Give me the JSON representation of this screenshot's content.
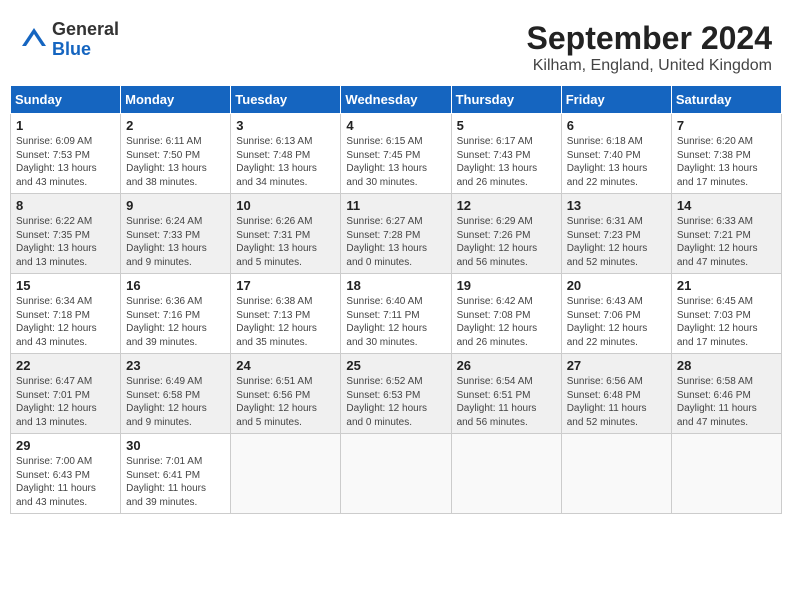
{
  "logo": {
    "general": "General",
    "blue": "Blue"
  },
  "header": {
    "month": "September 2024",
    "location": "Kilham, England, United Kingdom"
  },
  "weekdays": [
    "Sunday",
    "Monday",
    "Tuesday",
    "Wednesday",
    "Thursday",
    "Friday",
    "Saturday"
  ],
  "weeks": [
    [
      {
        "day": "1",
        "info": "Sunrise: 6:09 AM\nSunset: 7:53 PM\nDaylight: 13 hours\nand 43 minutes."
      },
      {
        "day": "2",
        "info": "Sunrise: 6:11 AM\nSunset: 7:50 PM\nDaylight: 13 hours\nand 38 minutes."
      },
      {
        "day": "3",
        "info": "Sunrise: 6:13 AM\nSunset: 7:48 PM\nDaylight: 13 hours\nand 34 minutes."
      },
      {
        "day": "4",
        "info": "Sunrise: 6:15 AM\nSunset: 7:45 PM\nDaylight: 13 hours\nand 30 minutes."
      },
      {
        "day": "5",
        "info": "Sunrise: 6:17 AM\nSunset: 7:43 PM\nDaylight: 13 hours\nand 26 minutes."
      },
      {
        "day": "6",
        "info": "Sunrise: 6:18 AM\nSunset: 7:40 PM\nDaylight: 13 hours\nand 22 minutes."
      },
      {
        "day": "7",
        "info": "Sunrise: 6:20 AM\nSunset: 7:38 PM\nDaylight: 13 hours\nand 17 minutes."
      }
    ],
    [
      {
        "day": "8",
        "info": "Sunrise: 6:22 AM\nSunset: 7:35 PM\nDaylight: 13 hours\nand 13 minutes."
      },
      {
        "day": "9",
        "info": "Sunrise: 6:24 AM\nSunset: 7:33 PM\nDaylight: 13 hours\nand 9 minutes."
      },
      {
        "day": "10",
        "info": "Sunrise: 6:26 AM\nSunset: 7:31 PM\nDaylight: 13 hours\nand 5 minutes."
      },
      {
        "day": "11",
        "info": "Sunrise: 6:27 AM\nSunset: 7:28 PM\nDaylight: 13 hours\nand 0 minutes."
      },
      {
        "day": "12",
        "info": "Sunrise: 6:29 AM\nSunset: 7:26 PM\nDaylight: 12 hours\nand 56 minutes."
      },
      {
        "day": "13",
        "info": "Sunrise: 6:31 AM\nSunset: 7:23 PM\nDaylight: 12 hours\nand 52 minutes."
      },
      {
        "day": "14",
        "info": "Sunrise: 6:33 AM\nSunset: 7:21 PM\nDaylight: 12 hours\nand 47 minutes."
      }
    ],
    [
      {
        "day": "15",
        "info": "Sunrise: 6:34 AM\nSunset: 7:18 PM\nDaylight: 12 hours\nand 43 minutes."
      },
      {
        "day": "16",
        "info": "Sunrise: 6:36 AM\nSunset: 7:16 PM\nDaylight: 12 hours\nand 39 minutes."
      },
      {
        "day": "17",
        "info": "Sunrise: 6:38 AM\nSunset: 7:13 PM\nDaylight: 12 hours\nand 35 minutes."
      },
      {
        "day": "18",
        "info": "Sunrise: 6:40 AM\nSunset: 7:11 PM\nDaylight: 12 hours\nand 30 minutes."
      },
      {
        "day": "19",
        "info": "Sunrise: 6:42 AM\nSunset: 7:08 PM\nDaylight: 12 hours\nand 26 minutes."
      },
      {
        "day": "20",
        "info": "Sunrise: 6:43 AM\nSunset: 7:06 PM\nDaylight: 12 hours\nand 22 minutes."
      },
      {
        "day": "21",
        "info": "Sunrise: 6:45 AM\nSunset: 7:03 PM\nDaylight: 12 hours\nand 17 minutes."
      }
    ],
    [
      {
        "day": "22",
        "info": "Sunrise: 6:47 AM\nSunset: 7:01 PM\nDaylight: 12 hours\nand 13 minutes."
      },
      {
        "day": "23",
        "info": "Sunrise: 6:49 AM\nSunset: 6:58 PM\nDaylight: 12 hours\nand 9 minutes."
      },
      {
        "day": "24",
        "info": "Sunrise: 6:51 AM\nSunset: 6:56 PM\nDaylight: 12 hours\nand 5 minutes."
      },
      {
        "day": "25",
        "info": "Sunrise: 6:52 AM\nSunset: 6:53 PM\nDaylight: 12 hours\nand 0 minutes."
      },
      {
        "day": "26",
        "info": "Sunrise: 6:54 AM\nSunset: 6:51 PM\nDaylight: 11 hours\nand 56 minutes."
      },
      {
        "day": "27",
        "info": "Sunrise: 6:56 AM\nSunset: 6:48 PM\nDaylight: 11 hours\nand 52 minutes."
      },
      {
        "day": "28",
        "info": "Sunrise: 6:58 AM\nSunset: 6:46 PM\nDaylight: 11 hours\nand 47 minutes."
      }
    ],
    [
      {
        "day": "29",
        "info": "Sunrise: 7:00 AM\nSunset: 6:43 PM\nDaylight: 11 hours\nand 43 minutes."
      },
      {
        "day": "30",
        "info": "Sunrise: 7:01 AM\nSunset: 6:41 PM\nDaylight: 11 hours\nand 39 minutes."
      },
      {
        "day": "",
        "info": ""
      },
      {
        "day": "",
        "info": ""
      },
      {
        "day": "",
        "info": ""
      },
      {
        "day": "",
        "info": ""
      },
      {
        "day": "",
        "info": ""
      }
    ]
  ]
}
